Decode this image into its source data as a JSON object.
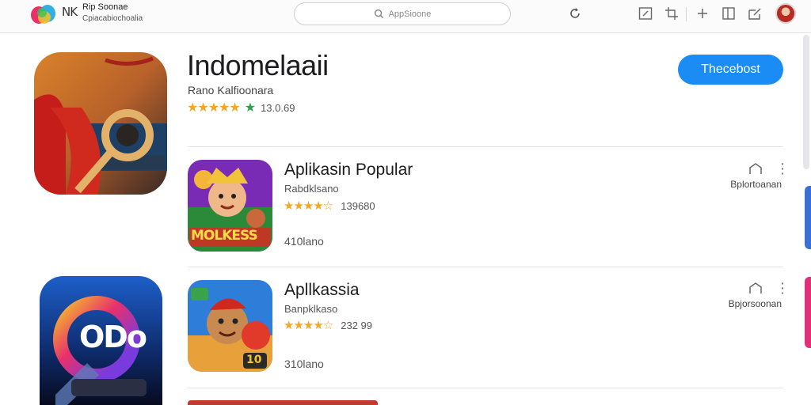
{
  "topbar": {
    "logo_mark": "NK",
    "brand_name": "Rip Soonae",
    "brand_sub": "Cpiacabiochoalia",
    "search_placeholder": "AppSioone",
    "icons": [
      "search-icon",
      "refresh-icon",
      "edit-icon",
      "crop-icon",
      "plus-icon",
      "sidebar-icon",
      "share-icon",
      "avatar"
    ]
  },
  "featured": {
    "title": "Indomelaaii",
    "developer": "Rano Kalfioonara",
    "stars": "★★★★★",
    "rating_text": "13.0.69",
    "button_label": "Thecebost"
  },
  "list": [
    {
      "title": "Aplikasin Popular",
      "developer": "Rabdklsano",
      "stars": "★★★★☆",
      "rating_text": "139680",
      "meta": "410lano",
      "right_label": "Bplortoanan",
      "icon_text": "MOLKESS"
    },
    {
      "title": "Apllkassia",
      "developer": "Banpklkaso",
      "stars": "★★★★☆",
      "rating_text": "232 99",
      "meta": "310lano",
      "right_label": "Bpjorsoonan",
      "icon_text": "10"
    }
  ],
  "side_icon_text": "ODo",
  "colors": {
    "accent": "#1c8cf5",
    "star": "#f5a623",
    "star_green": "#2aa34a"
  }
}
